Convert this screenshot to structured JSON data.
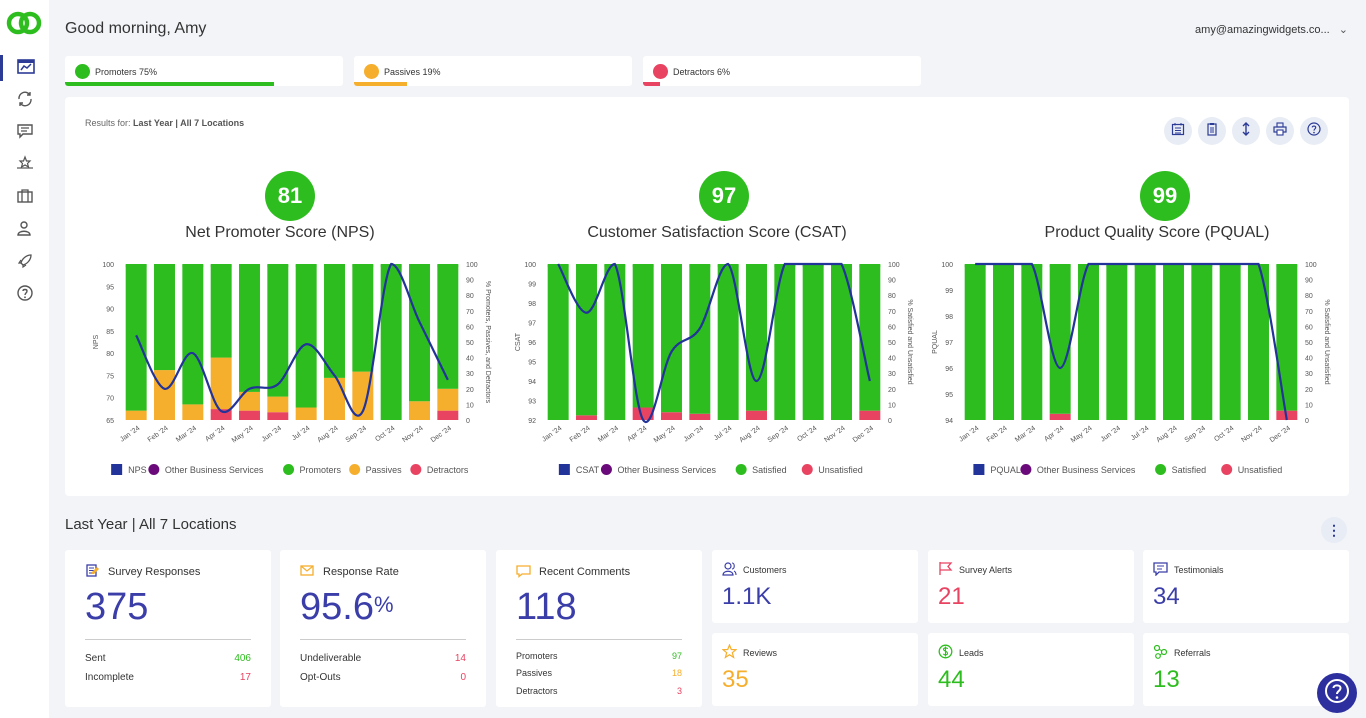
{
  "header": {
    "greeting": "Good morning, Amy",
    "user_email": "amy@amazingwidgets.co..."
  },
  "sidebar": {
    "items": [
      {
        "icon": "dashboard-icon"
      },
      {
        "icon": "sync-icon"
      },
      {
        "icon": "comments-icon"
      },
      {
        "icon": "stars-icon"
      },
      {
        "icon": "briefcase-icon"
      },
      {
        "icon": "users-icon"
      },
      {
        "icon": "rocket-icon"
      },
      {
        "icon": "help-icon"
      }
    ]
  },
  "sentiment": [
    {
      "label": "Promoters 75%",
      "percent": 75,
      "color": "#2ebd1f"
    },
    {
      "label": "Passives 19%",
      "percent": 19,
      "color": "#f6ae2d"
    },
    {
      "label": "Detractors 6%",
      "percent": 6,
      "color": "#e84361"
    }
  ],
  "results": {
    "prefix": "Results for:",
    "value": "Last Year | All 7 Locations"
  },
  "colors": {
    "green": "#2ebd1f",
    "orange": "#f6ae2d",
    "red": "#e84361",
    "navy": "#22339a",
    "purple": "#6a0a7a"
  },
  "months": [
    "Jan '24",
    "Feb '24",
    "Mar '24",
    "Apr '24",
    "May '24",
    "Jun '24",
    "Jul '24",
    "Aug '24",
    "Sep '24",
    "Oct '24",
    "Nov '24",
    "Dec '24"
  ],
  "chart_data": [
    {
      "type": "bar",
      "score": "81",
      "title": "Net Promoter Score (NPS)",
      "ylabel": "NPS",
      "y2label": "% Promoters, Passives, and Detractors",
      "ylim": [
        65,
        100
      ],
      "yticks": [
        "100",
        "95",
        "90",
        "85",
        "80",
        "75",
        "70",
        "65"
      ],
      "y2ticks": [
        "100",
        "90",
        "80",
        "70",
        "60",
        "50",
        "40",
        "30",
        "20",
        "10",
        "0"
      ],
      "series": [
        {
          "name": "NPS",
          "type": "line",
          "values": [
            84,
            72,
            80,
            67,
            72,
            73,
            82,
            75,
            67,
            100,
            87,
            74
          ]
        },
        {
          "name": "Promoters",
          "values": [
            94,
            68,
            90,
            60,
            82,
            85,
            92,
            73,
            69,
            100,
            88,
            80
          ]
        },
        {
          "name": "Passives",
          "values": [
            6,
            32,
            10,
            33,
            12,
            10,
            8,
            27,
            31,
            0,
            12,
            14
          ]
        },
        {
          "name": "Detractors",
          "values": [
            0,
            0,
            0,
            7,
            6,
            5,
            0,
            0,
            0,
            0,
            0,
            6
          ]
        }
      ],
      "legend": [
        "NPS",
        "Other Business Services",
        "Promoters",
        "Passives",
        "Detractors"
      ]
    },
    {
      "type": "bar",
      "score": "97",
      "title": "Customer Satisfaction Score (CSAT)",
      "ylabel": "CSAT",
      "y2label": "% Satisfied and Unsatisfied",
      "ylim": [
        92,
        100
      ],
      "yticks": [
        "100",
        "99",
        "98",
        "97",
        "96",
        "95",
        "94",
        "93",
        "92"
      ],
      "y2ticks": [
        "100",
        "90",
        "80",
        "70",
        "60",
        "50",
        "40",
        "30",
        "20",
        "10",
        "0"
      ],
      "series": [
        {
          "name": "CSAT",
          "type": "line",
          "values": [
            100,
            97.5,
            100,
            92,
            95.5,
            96.7,
            100,
            94,
            100,
            100,
            100,
            94
          ]
        },
        {
          "name": "Satisfied",
          "values": [
            100,
            97,
            100,
            92,
            95,
            96,
            100,
            94,
            100,
            100,
            100,
            94
          ]
        },
        {
          "name": "Unsatisfied",
          "values": [
            0,
            3,
            0,
            8,
            5,
            4,
            0,
            6,
            0,
            0,
            0,
            6
          ]
        }
      ],
      "legend": [
        "CSAT",
        "Other Business Services",
        "Satisfied",
        "Unsatisfied"
      ]
    },
    {
      "type": "bar",
      "score": "99",
      "title": "Product Quality Score (PQUAL)",
      "ylabel": "PQUAL",
      "y2label": "% Satisfied and Unsatisfied",
      "ylim": [
        94,
        100
      ],
      "yticks": [
        "100",
        "99",
        "98",
        "97",
        "96",
        "95",
        "94"
      ],
      "y2ticks": [
        "100",
        "90",
        "80",
        "70",
        "60",
        "50",
        "40",
        "30",
        "20",
        "10",
        "0"
      ],
      "series": [
        {
          "name": "PQUAL",
          "type": "line",
          "values": [
            100,
            100,
            100,
            96,
            100,
            100,
            100,
            100,
            100,
            100,
            100,
            94
          ]
        },
        {
          "name": "Satisfied",
          "values": [
            100,
            100,
            100,
            96,
            100,
            100,
            100,
            100,
            100,
            100,
            100,
            94
          ]
        },
        {
          "name": "Unsatisfied",
          "values": [
            0,
            0,
            0,
            4,
            0,
            0,
            0,
            0,
            0,
            0,
            0,
            6
          ]
        }
      ],
      "legend": [
        "PQUAL",
        "Other Business Services",
        "Satisfied",
        "Unsatisfied"
      ]
    }
  ],
  "section_title": "Last Year | All 7 Locations",
  "stats": {
    "survey": {
      "title": "Survey Responses",
      "value": "375",
      "rows": [
        {
          "label": "Sent",
          "value": "406",
          "color": "#2ebd1f"
        },
        {
          "label": "Incomplete",
          "value": "17",
          "color": "#e84361"
        }
      ]
    },
    "response": {
      "title": "Response Rate",
      "value": "95.6",
      "unit": "%",
      "rows": [
        {
          "label": "Undeliverable",
          "value": "14",
          "color": "#e84361"
        },
        {
          "label": "Opt-Outs",
          "value": "0",
          "color": "#e84361"
        }
      ]
    },
    "comments": {
      "title": "Recent Comments",
      "value": "118",
      "rows": [
        {
          "label": "Promoters",
          "value": "97",
          "color": "#2ebd1f"
        },
        {
          "label": "Passives",
          "value": "18",
          "color": "#f6ae2d"
        },
        {
          "label": "Detractors",
          "value": "3",
          "color": "#e84361"
        }
      ]
    }
  },
  "kpis": [
    {
      "label": "Customers",
      "value": "1.1K",
      "color": "#3b3ea8",
      "icon": "customers-icon"
    },
    {
      "label": "Survey Alerts",
      "value": "21",
      "color": "#e84361",
      "icon": "flag-icon"
    },
    {
      "label": "Testimonials",
      "value": "34",
      "color": "#3b3ea8",
      "icon": "testimonial-icon"
    },
    {
      "label": "Reviews",
      "value": "35",
      "color": "#f6ae2d",
      "icon": "star-icon"
    },
    {
      "label": "Leads",
      "value": "44",
      "color": "#2ebd1f",
      "icon": "dollar-icon"
    },
    {
      "label": "Referrals",
      "value": "13",
      "color": "#2ebd1f",
      "icon": "referrals-icon"
    }
  ]
}
